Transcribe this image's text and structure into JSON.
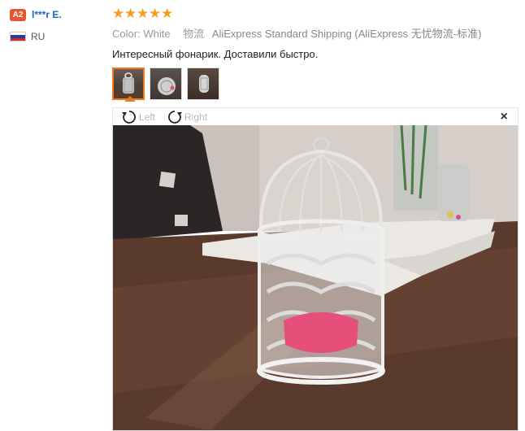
{
  "reviewer": {
    "level": "A2",
    "name": "l***r E.",
    "country": "RU"
  },
  "review": {
    "rating": 5,
    "stars": [
      "★",
      "★",
      "★",
      "★",
      "★"
    ],
    "color_label": "Color:",
    "color_value": "White",
    "shipping_label": "物流",
    "shipping_value": "AliExpress Standard Shipping (AliExpress 无忧物流-标准)",
    "comment": "Интересный фонарик. Доставили быстро."
  },
  "viewer": {
    "rotate_left": "Left",
    "rotate_right": "Right",
    "close": "×"
  },
  "colors": {
    "accent": "#f0781e",
    "star": "#f59e1e",
    "badge": "#e8542e",
    "link": "#1f63c3"
  }
}
